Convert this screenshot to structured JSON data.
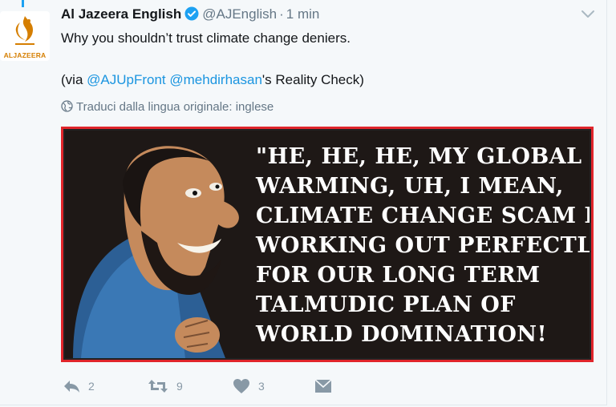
{
  "author": {
    "name": "Al Jazeera English",
    "handle": "@AJEnglish",
    "separator": "·",
    "time": "1 min",
    "avatar_text": "ALJAZEERA"
  },
  "tweet": {
    "line1": "Why you shouldn’t trust climate change deniers.",
    "line2_prefix": "(via ",
    "mention1": "@AJUpFront",
    "mention2": "@mehdirhasan",
    "line2_suffix": "'s Reality Check)"
  },
  "translate_label": "Traduci dalla lingua originale: inglese",
  "media": {
    "caption_lines": [
      "\"HE, HE, HE, MY GLOBAL",
      "WARMING, UH, I MEAN,",
      "CLIMATE CHANGE SCAM IS",
      "WORKING OUT PERFECTLY",
      "FOR OUR LONG TERM",
      "TALMUDIC PLAN OF",
      "WORLD DOMINATION!"
    ],
    "border_color": "#e0252b"
  },
  "actions": {
    "reply_count": "2",
    "retweet_count": "9",
    "like_count": "3"
  },
  "colors": {
    "link": "#1b95e0",
    "verified": "#1da1f2",
    "muted": "#657786"
  }
}
